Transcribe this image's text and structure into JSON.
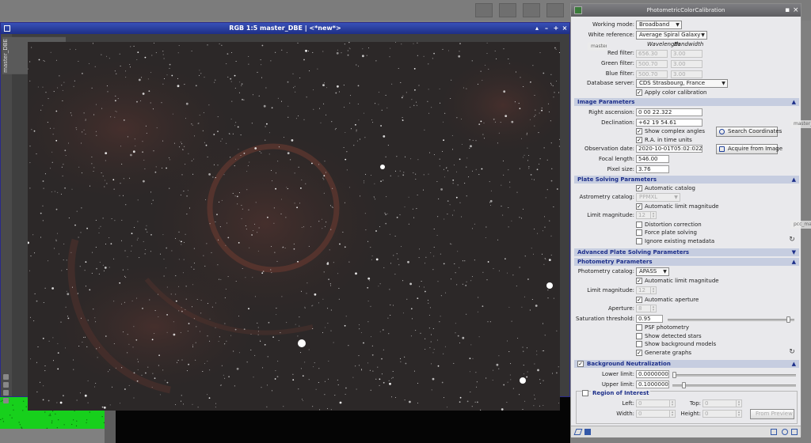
{
  "image_window": {
    "title": "RGB 1:5 master_DBE | <*new*>",
    "view_tab": "master_DBE"
  },
  "colors": {
    "titlebar": "#2a3d9e",
    "accent_green": "#17d01c",
    "section_bg": "#c6cde0",
    "section_text": "#1d2f8a",
    "dialog_bg": "#e9e9ec"
  },
  "dialog": {
    "title": "PhotometricColorCalibration",
    "working_mode_label": "Working mode:",
    "working_mode": "Broadband",
    "white_ref_label": "White reference:",
    "white_ref": "Average Spiral Galaxy",
    "wavelength_header": "Wavelength",
    "bandwidth_header": "Bandwidth",
    "red_filter_label": "Red filter:",
    "red_wavelength": "656.30",
    "red_bandwidth": "3.00",
    "green_filter_label": "Green filter:",
    "green_wavelength": "500.70",
    "green_bandwidth": "3.00",
    "blue_filter_label": "Blue filter:",
    "blue_wavelength": "500.70",
    "blue_bandwidth": "3.00",
    "db_server_label": "Database server:",
    "db_server": "CDS Strasbourg, France",
    "apply_color_calibration": "Apply color calibration",
    "image_params": {
      "header": "Image Parameters",
      "ra_label": "Right ascension:",
      "ra": "0 00 22.322",
      "dec_label": "Declination:",
      "dec": "+62 19 54.61",
      "show_complex_angles": "Show complex angles",
      "ra_time_units": "R.A. in time units",
      "obs_date_label": "Observation date:",
      "obs_date": "2020-10-01T05:02:02Z",
      "focal_label": "Focal length:",
      "focal": "546.00",
      "pixel_label": "Pixel size:",
      "pixel": "3.76",
      "search_button": "Search Coordinates",
      "acquire_button": "Acquire from Image"
    },
    "plate_solving": {
      "header": "Plate Solving Parameters",
      "automatic_catalog": "Automatic catalog",
      "astrometry_catalog_label": "Astrometry catalog:",
      "astrometry_catalog": "PPMXL",
      "automatic_limit_mag": "Automatic limit magnitude",
      "limit_mag_label": "Limit magnitude:",
      "limit_mag": "12",
      "distortion": "Distortion correction",
      "force": "Force plate solving",
      "ignore_meta": "Ignore existing metadata"
    },
    "advanced_header": "Advanced Plate Solving Parameters",
    "photometry": {
      "header": "Photometry Parameters",
      "catalog_label": "Photometry catalog:",
      "catalog": "APASS",
      "automatic_limit_mag": "Automatic limit magnitude",
      "limit_mag_label": "Limit magnitude:",
      "limit_mag": "12",
      "automatic_aperture": "Automatic aperture",
      "aperture_label": "Aperture:",
      "aperture": "8",
      "saturation_label": "Saturation threshold:",
      "saturation": "0.95",
      "psf": "PSF photometry",
      "show_stars": "Show detected stars",
      "show_bg": "Show background models",
      "gen_graphs": "Generate graphs"
    },
    "background": {
      "header": "Background Neutralization",
      "lower_label": "Lower limit:",
      "lower": "0.0000000",
      "upper_label": "Upper limit:",
      "upper": "0.1000000",
      "roi_label": "Region of Interest",
      "left_label": "Left:",
      "left": "0",
      "top_label": "Top:",
      "top": "0",
      "width_label": "Width:",
      "width": "0",
      "height_label": "Height:",
      "height": "0",
      "from_preview": "From Preview"
    }
  },
  "shelves": {
    "a": "master_DBE",
    "b": "master_DBE_crop",
    "c": "pcc_master_DBE"
  }
}
